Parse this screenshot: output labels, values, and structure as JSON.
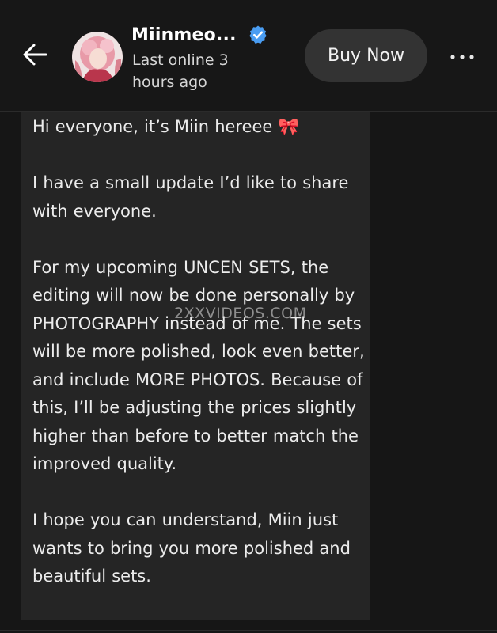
{
  "header": {
    "name": "Miinmeo...",
    "status": "Last online 3 hours ago",
    "buy_label": "Buy Now"
  },
  "message": {
    "text": "Hi everyone, it’s Miin hereee 🎀\n\nI have a small update I’d like to share with everyone.\n\nFor my upcoming UNCEN SETS, the editing will now be done personally by PHOTOGRAPHY instead of me. The sets will be more polished, look even better, and include MORE PHOTOS. Because of this, I’ll be adjusting the prices slightly higher than before to better match the improved quality.\n\nI hope you can understand, Miin just wants to bring you more polished and beautiful sets."
  },
  "watermark": "2XXVIDEOS.COM",
  "icons": [
    "back-arrow-icon",
    "verified-badge-icon",
    "more-options-icon"
  ],
  "colors": {
    "background": "#161616",
    "bubble": "#252525",
    "button": "#333333",
    "verified": "#4a9df2",
    "text": "#ececec"
  }
}
